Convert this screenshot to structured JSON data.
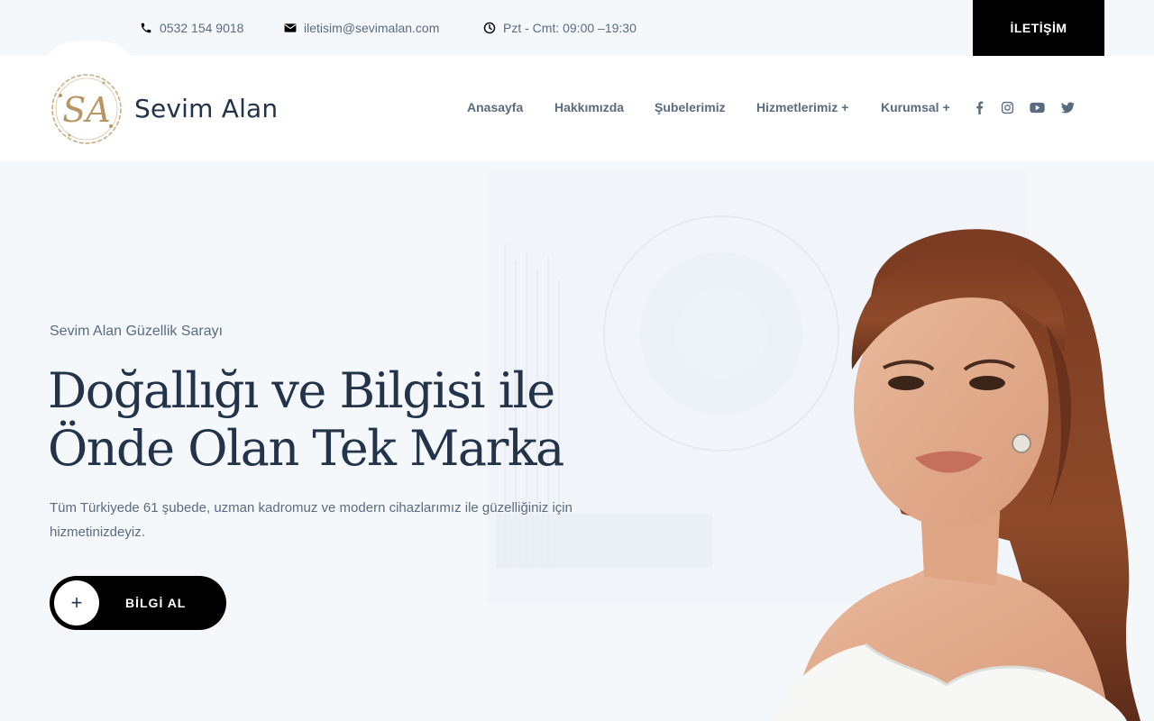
{
  "topbar": {
    "phone": "0532 154 9018",
    "email": "iletisim@sevimalan.com",
    "hours": "Pzt - Cmt: 09:00 –19:30",
    "contact_button": "İLETİŞİM"
  },
  "header": {
    "brand_name": "Sevim Alan",
    "logo_monogram": "SA",
    "nav": [
      "Anasayfa",
      "Hakkımızda",
      "Şubelerimiz",
      "Hizmetlerimiz +",
      "Kurumsal +"
    ],
    "socials": [
      "facebook-icon",
      "instagram-icon",
      "youtube-icon",
      "twitter-icon"
    ]
  },
  "hero": {
    "subtitle": "Sevim Alan Güzellik Sarayı",
    "title_line1": "Doğallığı ve Bilgisi ile",
    "title_line2": "Önde Olan Tek Marka",
    "description": "Tüm Türkiyede 61 şubede, uzman kadromuz ve modern cihazlarımız ile güzelliğiniz için hizmetinizdeyiz.",
    "cta_icon": "+",
    "cta_label": "BİLGİ AL"
  },
  "colors": {
    "background": "#f4f8fb",
    "text_dark": "#22334a",
    "text_muted": "#5b6b7e",
    "accent_black": "#000000",
    "logo_gold": "#b89562"
  }
}
